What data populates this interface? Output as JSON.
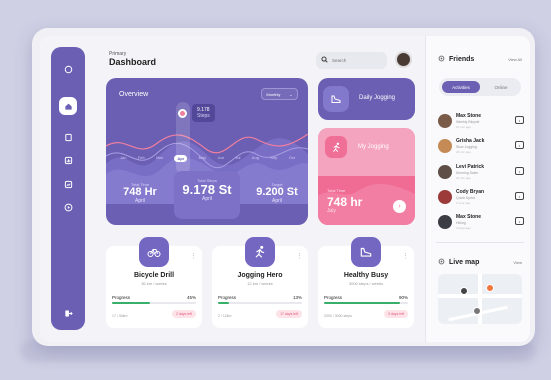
{
  "header": {
    "subtitle": "Primary",
    "title": "Dashboard",
    "search_placeholder": "Search"
  },
  "sidebar": {
    "icons": [
      "bell-icon",
      "home-icon",
      "document-icon",
      "chart-icon",
      "trend-icon",
      "play-icon",
      "logout-icon"
    ],
    "active": "home-icon"
  },
  "overview": {
    "title": "Overview",
    "period": "Monthly",
    "months": [
      "Jan",
      "Feb",
      "Mar",
      "Apr",
      "May",
      "Jun",
      "Jul",
      "Aug",
      "Sep",
      "Oct"
    ],
    "active_month": "Apr",
    "tooltip": {
      "value": "9.178",
      "unit": "Steps"
    },
    "stats": [
      {
        "label": "Total Time",
        "value": "748 Hr",
        "sub": "April"
      },
      {
        "label": "Total Steps",
        "value": "9.178 St",
        "sub": "April"
      },
      {
        "label": "Target",
        "value": "9.200 St",
        "sub": "April"
      }
    ]
  },
  "daily_jogging": {
    "label": "Daily Jogging"
  },
  "my_jogging": {
    "label": "My Jogging",
    "stat_label": "Total Time",
    "value": "748 hr",
    "sub": "July"
  },
  "activities": [
    {
      "name": "Bicycle Drill",
      "desc": "36 km / weeks",
      "progress_label": "Progress",
      "progress": "45%",
      "progress_value": 45,
      "date": "17 / 30km",
      "left": "2 days left",
      "icon": "bicycle-icon"
    },
    {
      "name": "Jogging Hero",
      "desc": "12 km / weeks",
      "progress_label": "Progress",
      "progress": "13%",
      "progress_value": 13,
      "date": "2 / 12km",
      "left": "17 days left",
      "icon": "runner-icon"
    },
    {
      "name": "Healthy Busy",
      "desc": "3000 steps / weeks",
      "progress_label": "Progress",
      "progress": "90%",
      "progress_value": 90,
      "date": "2000 / 3000 steps",
      "left": "3 days left",
      "icon": "shoe-icon"
    }
  ],
  "friends": {
    "title": "Friends",
    "view_all": "View All",
    "tabs": [
      "Activities",
      "Online"
    ],
    "list": [
      {
        "name": "Max Stone",
        "activity": "Weekly Bicycle",
        "time": "10 min ago",
        "color": "#7a5a48"
      },
      {
        "name": "Grisha Jack",
        "activity": "Slow Jogging",
        "time": "23 min ago",
        "color": "#c58b57"
      },
      {
        "name": "Levi Patrick",
        "activity": "Morning Swim",
        "time": "34 min ago",
        "color": "#5e4e45"
      },
      {
        "name": "Cody Bryan",
        "activity": "Quick Sprint",
        "time": "1 hour ago",
        "color": "#9c3a3a"
      },
      {
        "name": "Max Stone",
        "activity": "Hiking",
        "time": "2 days ago",
        "color": "#3c3c44"
      }
    ]
  },
  "live_map": {
    "title": "Live map",
    "view": "View"
  },
  "colors": {
    "primary": "#6a5fb3",
    "accent": "#f06c95",
    "success": "#39b06a"
  }
}
